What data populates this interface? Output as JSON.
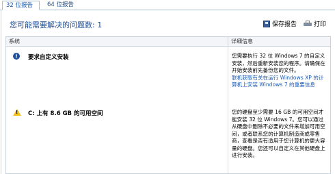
{
  "tabs": [
    {
      "label": "32 位报告",
      "active": true
    },
    {
      "label": "64 位报告",
      "active": false
    }
  ],
  "header": {
    "title": "您可能需要解决的问题数: 1",
    "save_label": "保存报告",
    "print_label": "打印"
  },
  "table": {
    "columns": [
      "系统",
      "详细信息"
    ],
    "rows": [
      {
        "icon": "info-icon",
        "title": "要求自定义安装",
        "detail": "您需要执行 32 位 Windows 7 的自定义安装，然后重新安装您的程序。请确保在开始安装前先备份您的文件。",
        "link": "联机获取有关在运行 Windows XP 的计算机上安装 Windows 7 的重要信息"
      },
      {
        "icon": "warning-icon",
        "title": "C: 上有 8.6 GB 的可用空间",
        "detail": "您的硬盘至少需要 16 GB 的可用空间才能安装 32 位 Windows 7。您可以通过从硬盘中删除不必要的文件来增加可用空间，或者联系您的计算机制造商或零售商，查看是否有适用于您计算机的更大容量的硬盘。您还可以自定义在其他硬盘上进行安装。"
      }
    ]
  },
  "colors": {
    "accent": "#1f4e9a",
    "link": "#1a5ab4",
    "warning": "#f2c21a"
  }
}
